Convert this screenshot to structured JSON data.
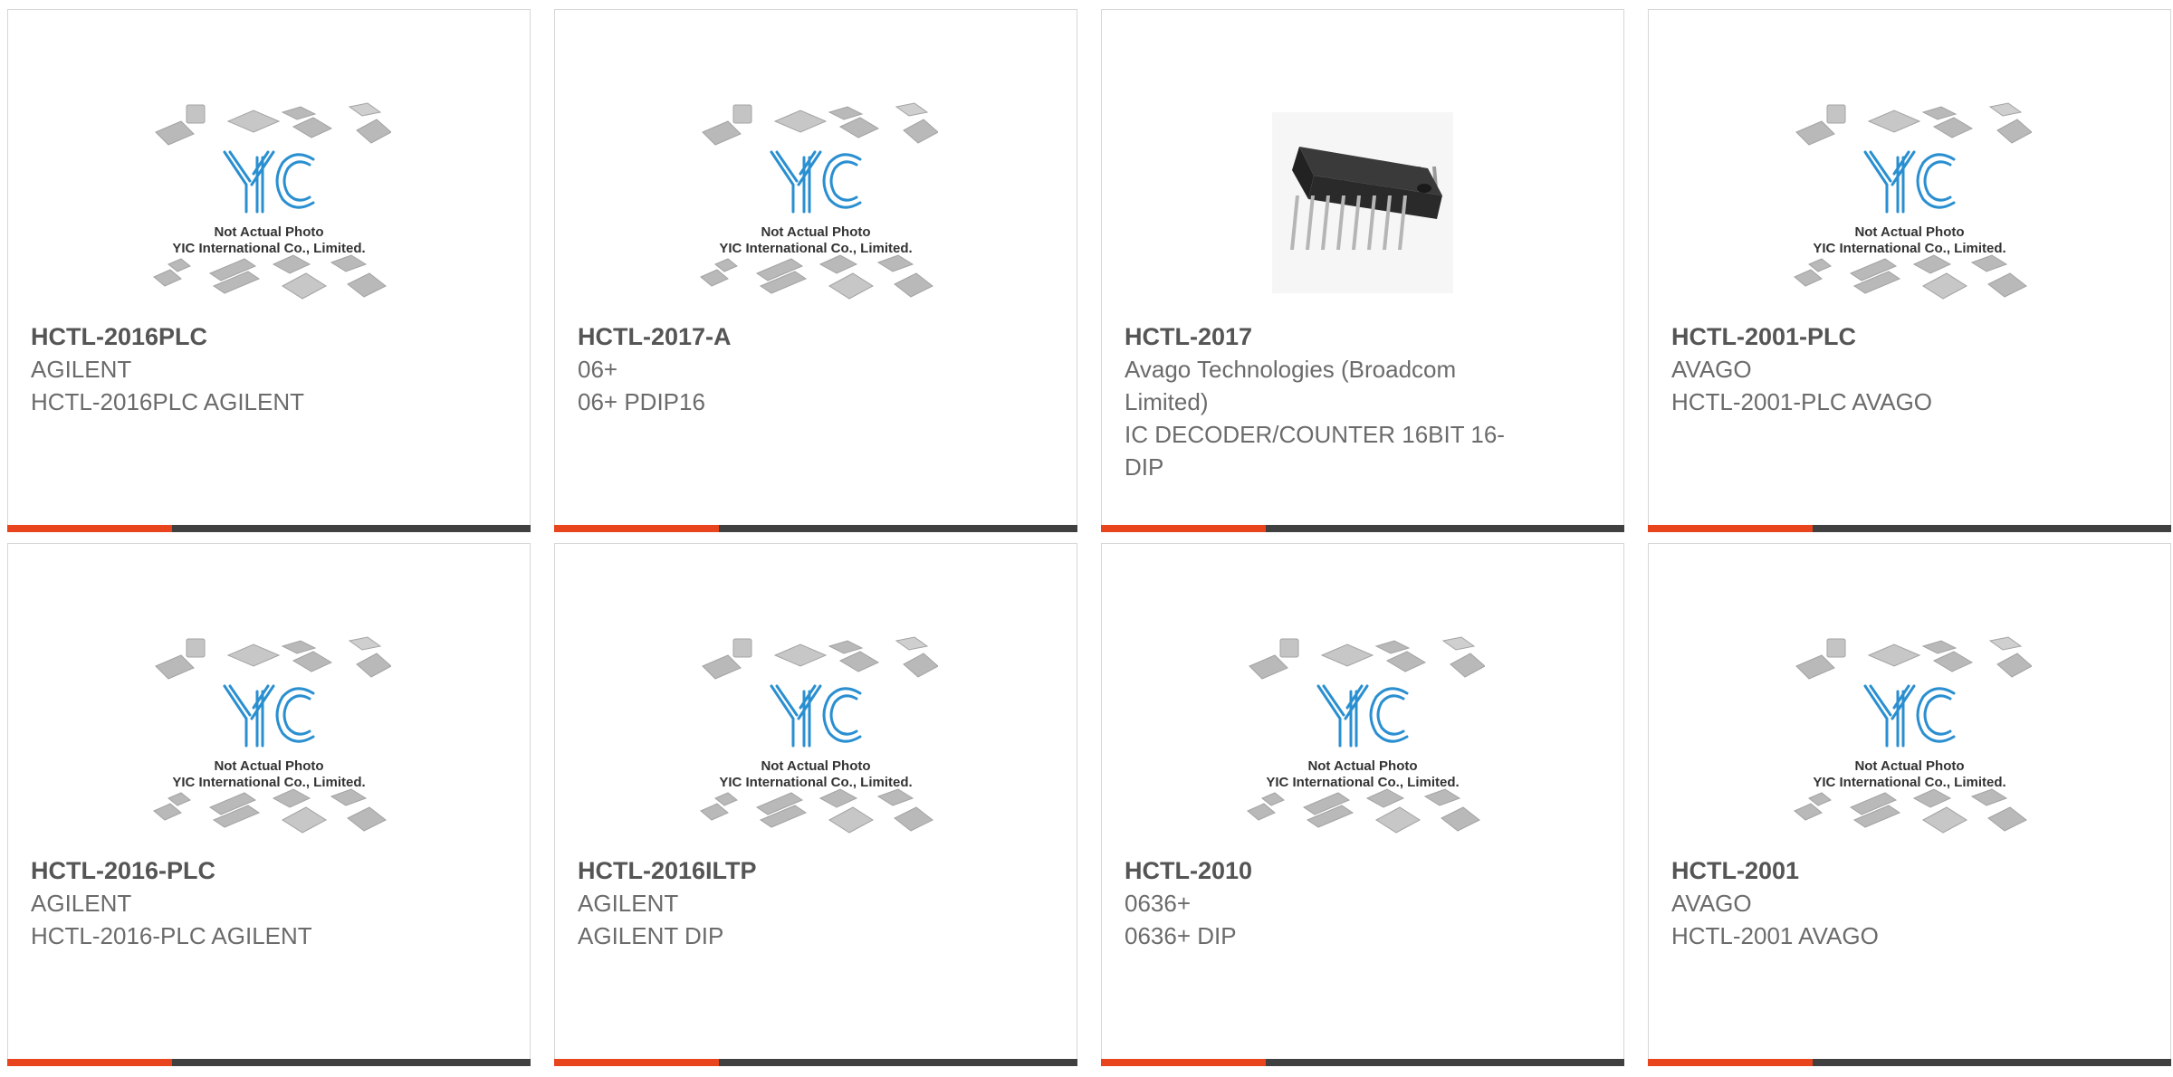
{
  "placeholder": {
    "line1": "Not Actual Photo",
    "line2": "YIC International Co., Limited.",
    "logo": "YIC"
  },
  "colors": {
    "accent": "#e8451e",
    "bar": "#404040",
    "logo_blue": "#2a8fd0"
  },
  "products": [
    {
      "pn": "HCTL-2016PLC",
      "line1": "AGILENT",
      "line2": "HCTL-2016PLC AGILENT",
      "image": "placeholder"
    },
    {
      "pn": "HCTL-2017-A",
      "line1": "06+",
      "line2": "06+ PDIP16",
      "image": "placeholder"
    },
    {
      "pn": "HCTL-2017",
      "line1": "Avago Technologies (Broadcom Limited)",
      "line2": "IC DECODER/COUNTER 16BIT 16-DIP",
      "image": "dip-chip-photo"
    },
    {
      "pn": "HCTL-2001-PLC",
      "line1": "AVAGO",
      "line2": "HCTL-2001-PLC AVAGO",
      "image": "placeholder"
    },
    {
      "pn": "HCTL-2016-PLC",
      "line1": "AGILENT",
      "line2": "HCTL-2016-PLC AGILENT",
      "image": "placeholder"
    },
    {
      "pn": "HCTL-2016ILTP",
      "line1": "AGILENT",
      "line2": "AGILENT DIP",
      "image": "placeholder"
    },
    {
      "pn": "HCTL-2010",
      "line1": "0636+",
      "line2": "0636+ DIP",
      "image": "placeholder"
    },
    {
      "pn": "HCTL-2001",
      "line1": "AVAGO",
      "line2": "HCTL-2001 AVAGO",
      "image": "placeholder"
    }
  ]
}
